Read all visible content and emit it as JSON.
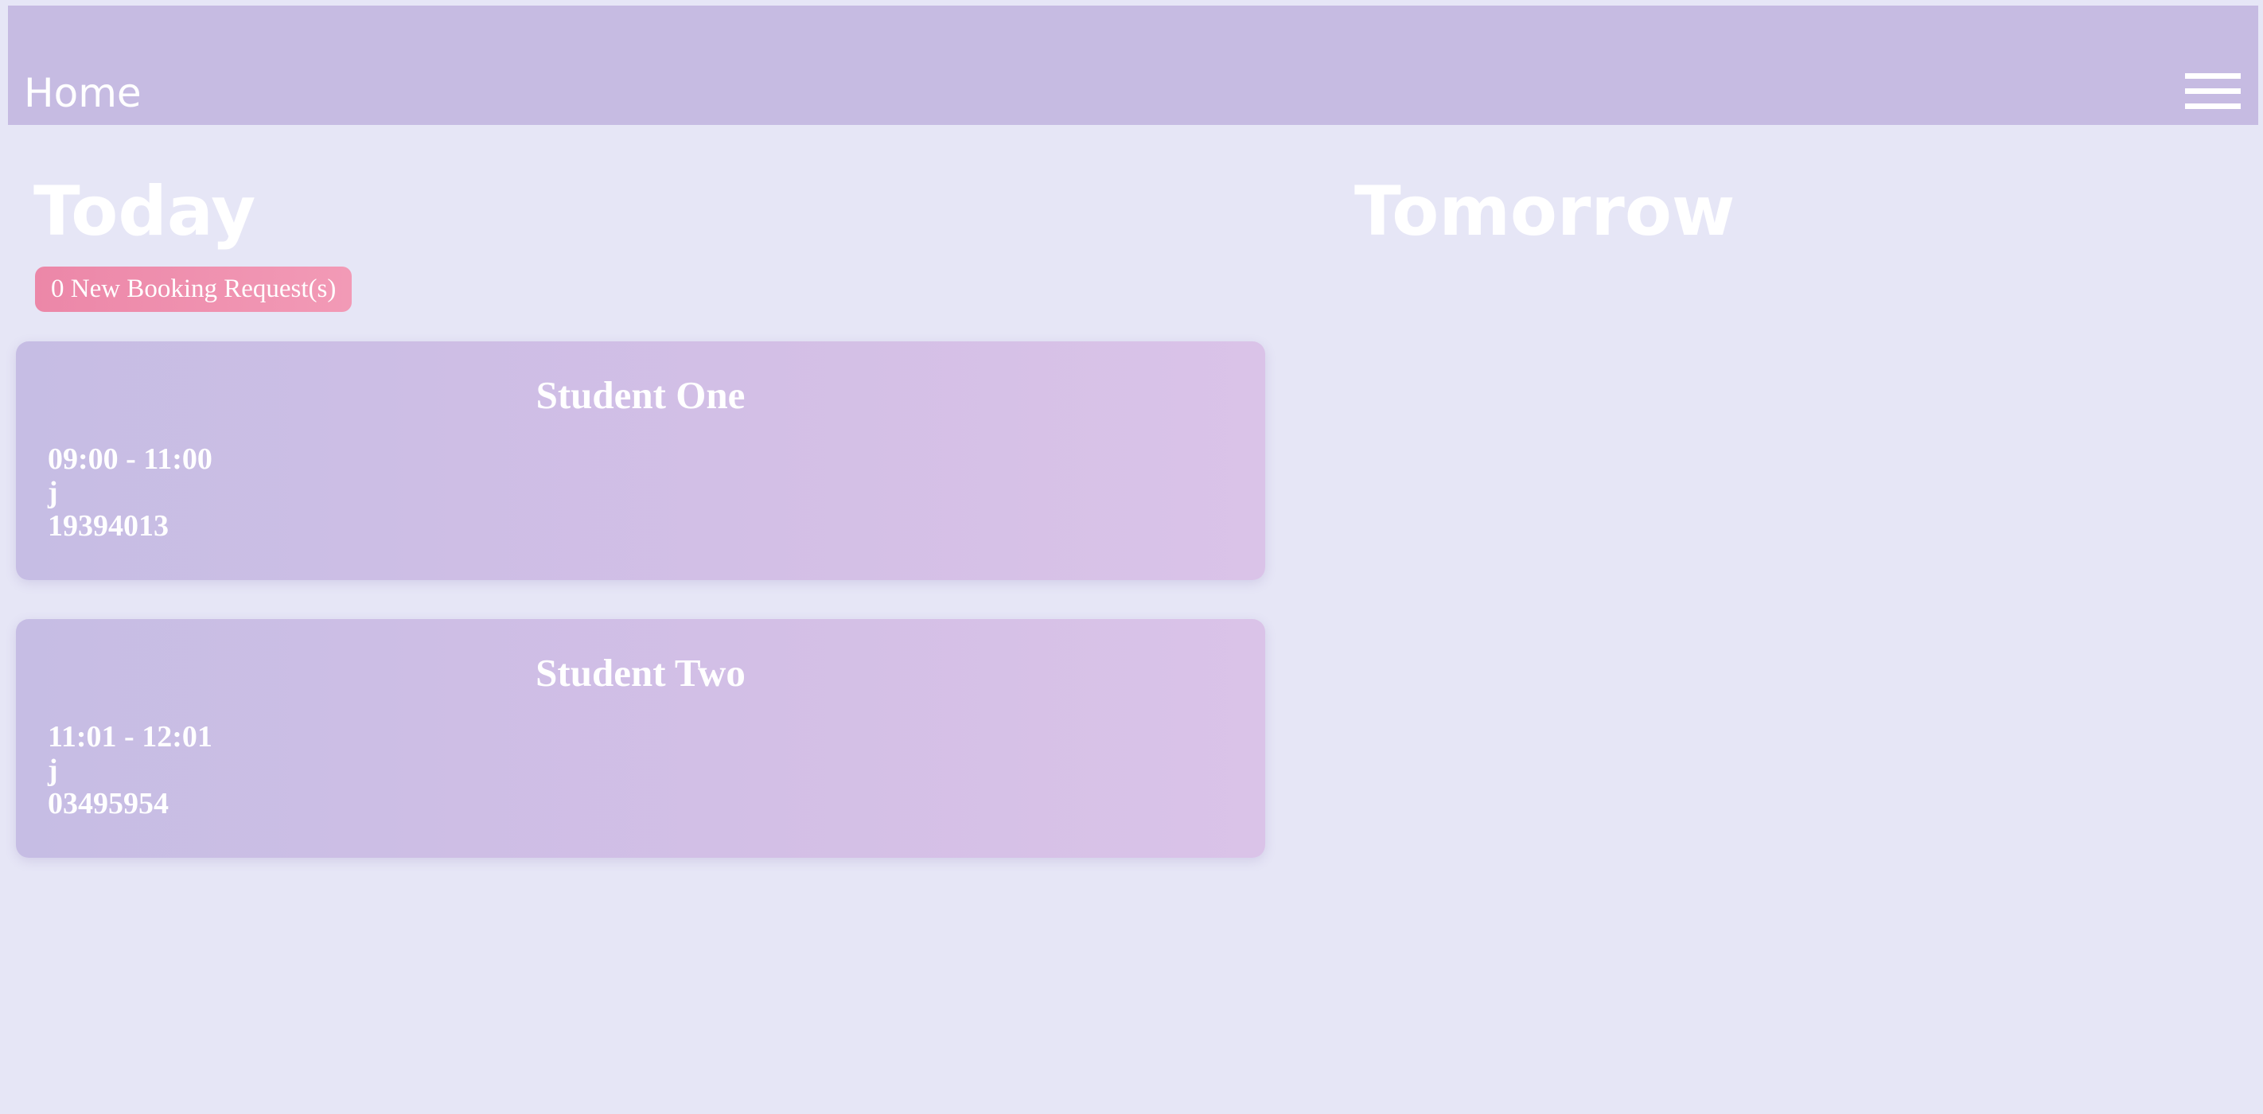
{
  "header": {
    "title": "Home",
    "menu_icon": "hamburger-menu-icon"
  },
  "today": {
    "heading": "Today",
    "requests_badge": "0 New Booking Request(s)",
    "bookings": [
      {
        "student": "Student One",
        "time": "09:00 - 11:00",
        "note": "j",
        "phone": "19394013"
      },
      {
        "student": "Student Two",
        "time": "11:01 - 12:01",
        "note": "j",
        "phone": "03495954"
      }
    ]
  },
  "tomorrow": {
    "heading": "Tomorrow"
  },
  "colors": {
    "background": "#e6e6f6",
    "top_bar": "#c6bbe2",
    "badge": "#ec87a8",
    "card": "#d3bfe6",
    "text": "#ffffff"
  }
}
